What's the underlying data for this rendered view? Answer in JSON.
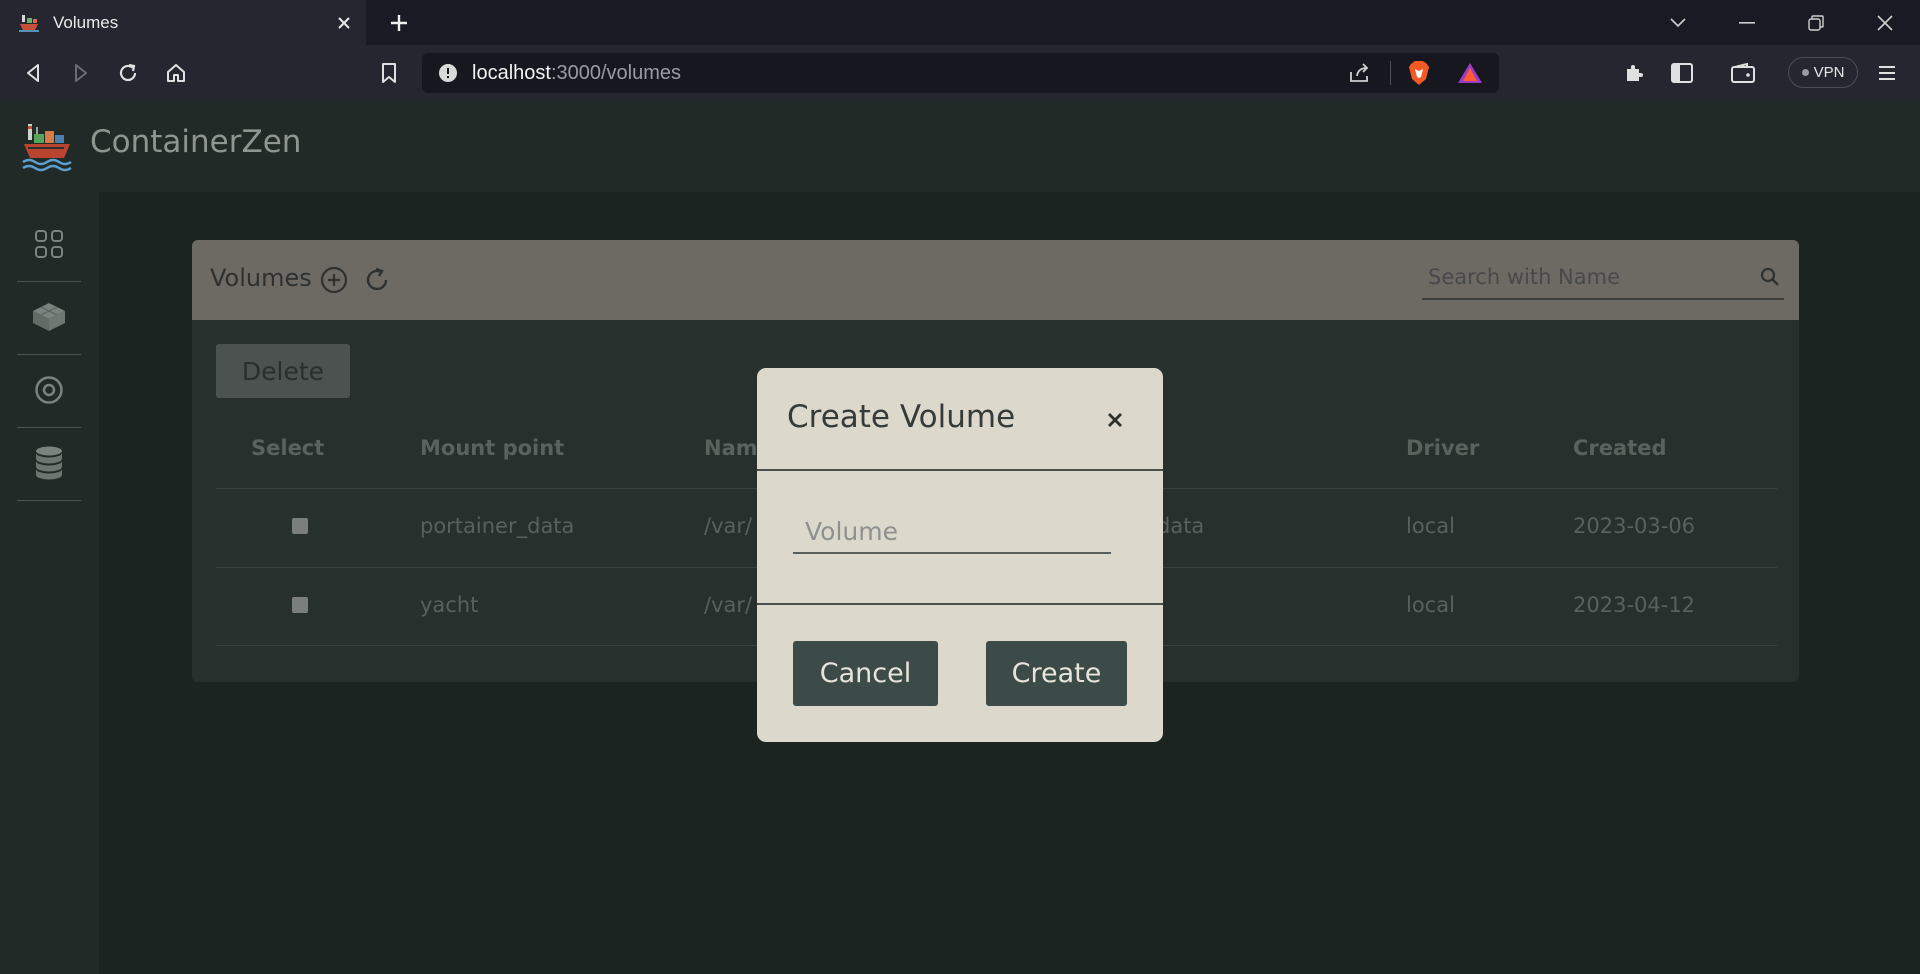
{
  "browser": {
    "tab_title": "Volumes",
    "url_host": "localhost",
    "url_path": ":3000/volumes",
    "vpn_label": "VPN"
  },
  "app": {
    "brand_name": "ContainerZen"
  },
  "sidebar": {
    "items": [
      {
        "icon": "dashboard-grid-icon"
      },
      {
        "icon": "cube-icon"
      },
      {
        "icon": "disc-icon"
      },
      {
        "icon": "database-icon"
      }
    ]
  },
  "volumes": {
    "title": "Volumes",
    "search_placeholder": "Search with Name",
    "delete_label": "Delete",
    "columns": {
      "select": "Select",
      "mount_point": "Mount point",
      "name": "Nam",
      "driver": "Driver",
      "created": "Created"
    },
    "rows": [
      {
        "mount_point": "portainer_data",
        "name_start": "/var/",
        "name_end": "data",
        "driver": "local",
        "created": "2023-03-06"
      },
      {
        "mount_point": "yacht",
        "name_start": "/var/",
        "name_end": "",
        "driver": "local",
        "created": "2023-04-12"
      }
    ]
  },
  "modal": {
    "title": "Create Volume",
    "input_placeholder": "Volume",
    "input_value": "",
    "cancel_label": "Cancel",
    "create_label": "Create"
  },
  "colors": {
    "header_bar": "#6d6963",
    "modal_bg": "#ddd8cc",
    "button_dark": "#3c4a48",
    "page_bg": "#1c2422"
  }
}
